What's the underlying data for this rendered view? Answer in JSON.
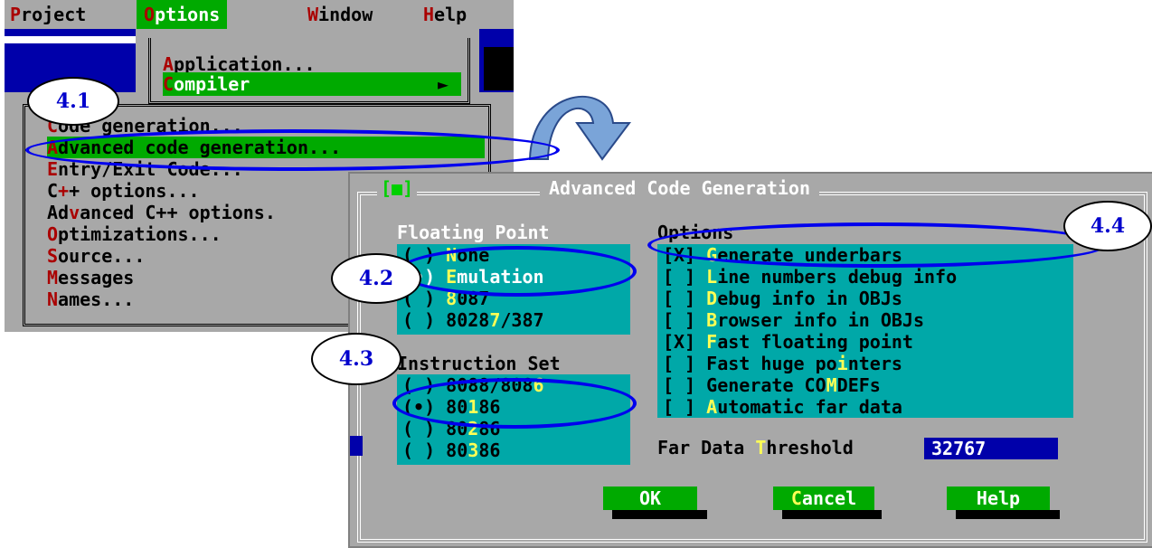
{
  "menubar": {
    "items": [
      {
        "hotkey": "P",
        "rest": "roject"
      },
      {
        "hotkey": "O",
        "rest": "ptions"
      },
      {
        "hotkey": "W",
        "rest": "indow"
      },
      {
        "hotkey": "H",
        "rest": "elp"
      }
    ]
  },
  "options_menu": {
    "application": {
      "hotkey": "A",
      "rest": "pplication..."
    },
    "compiler": {
      "hotkey": "C",
      "rest": "ompiler",
      "arrow": "►"
    }
  },
  "compiler_submenu": {
    "items": [
      {
        "hotkey": "C",
        "rest": "ode generation..."
      },
      {
        "hotkey": "A",
        "rest": "dvanced code generation..."
      },
      {
        "hotkey": "E",
        "rest": "ntry/Exit Code..."
      },
      {
        "pre": "C",
        "hotkey": "+",
        "rest": "+ options..."
      },
      {
        "pre": "Ad",
        "hotkey": "v",
        "rest": "anced C++ options."
      },
      {
        "hotkey": "O",
        "rest": "ptimizations..."
      },
      {
        "hotkey": "S",
        "rest": "ource..."
      },
      {
        "hotkey": "M",
        "rest": "essages"
      },
      {
        "hotkey": "N",
        "rest": "ames..."
      }
    ]
  },
  "dialog": {
    "title": "Advanced Code Generation",
    "close_box": "[■]",
    "floating_point": {
      "label": "Floating Point",
      "options": [
        {
          "radio": "( )",
          "pre": "",
          "hotkey": "N",
          "rest": "one",
          "selected": false
        },
        {
          "radio": "(•)",
          "pre": "",
          "hotkey": "E",
          "rest": "mulation",
          "selected": true
        },
        {
          "radio": "( )",
          "pre": "",
          "hotkey": "8",
          "rest": "087",
          "selected": false
        },
        {
          "radio": "( )",
          "pre": "8028",
          "hotkey": "7",
          "rest": "/387",
          "selected": false
        }
      ]
    },
    "instruction_set": {
      "label": "Instruction Set",
      "options": [
        {
          "radio": "( )",
          "pre": "8088/808",
          "hotkey": "6",
          "rest": "",
          "selected": false
        },
        {
          "radio": "(•)",
          "pre": "80",
          "hotkey": "1",
          "rest": "86",
          "selected": true
        },
        {
          "radio": "( )",
          "pre": "80",
          "hotkey": "2",
          "rest": "86",
          "selected": false
        },
        {
          "radio": "( )",
          "pre": "80",
          "hotkey": "3",
          "rest": "86",
          "selected": false
        }
      ]
    },
    "options": {
      "label": "Options",
      "items": [
        {
          "box": "[X]",
          "pre": "",
          "hotkey": "G",
          "rest": "enerate underbars"
        },
        {
          "box": "[ ]",
          "pre": "",
          "hotkey": "L",
          "rest": "ine numbers debug info"
        },
        {
          "box": "[ ]",
          "pre": "",
          "hotkey": "D",
          "rest": "ebug info in OBJs"
        },
        {
          "box": "[ ]",
          "pre": "",
          "hotkey": "B",
          "rest": "rowser info in OBJs"
        },
        {
          "box": "[X]",
          "pre": "",
          "hotkey": "F",
          "rest": "ast floating point"
        },
        {
          "box": "[ ]",
          "pre": "Fast huge po",
          "hotkey": "i",
          "rest": "nters"
        },
        {
          "box": "[ ]",
          "pre": "Generate CO",
          "hotkey": "M",
          "rest": "DEFs"
        },
        {
          "box": "[ ]",
          "pre": "",
          "hotkey": "A",
          "rest": "utomatic far data"
        }
      ]
    },
    "far_data": {
      "pre": "Far Data ",
      "hotkey": "T",
      "rest": "hreshold",
      "value": "32767"
    },
    "buttons": {
      "ok": "OK",
      "cancel_hotkey": "C",
      "cancel_rest": "ancel",
      "help": "Help"
    }
  },
  "callouts": {
    "c41": "4.1",
    "c42": "4.2",
    "c43": "4.3",
    "c44": "4.4"
  },
  "colors": {
    "highlight": "#00aa00",
    "panel": "#00a8a8",
    "hotkey": "#ffff55",
    "ring": "#0000ee",
    "arrow": "#7aa4d8"
  }
}
